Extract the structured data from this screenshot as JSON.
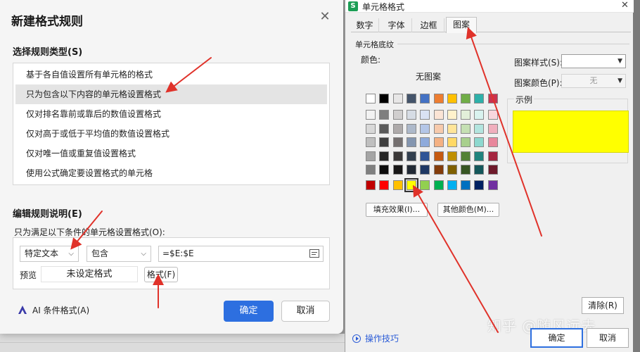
{
  "left_dialog": {
    "title": "新建格式规则",
    "rule_type_heading": "选择规则类型(S)",
    "rule_types": [
      {
        "label": "基于各自值设置所有单元格的格式",
        "selected": false
      },
      {
        "label": "只为包含以下内容的单元格设置格式",
        "selected": true
      },
      {
        "label": "仅对排名靠前或靠后的数值设置格式",
        "selected": false
      },
      {
        "label": "仅对高于或低于平均值的数值设置格式",
        "selected": false
      },
      {
        "label": "仅对唯一值或重复值设置格式",
        "selected": false
      },
      {
        "label": "使用公式确定要设置格式的单元格",
        "selected": false
      }
    ],
    "edit_heading": "编辑规则说明(E)",
    "condition_label": "只为满足以下条件的单元格设置格式(O):",
    "condition_type": "特定文本",
    "operator": "包含",
    "formula_value": "=$E:$E",
    "preview_label": "预览",
    "preview_text": "未设定格式",
    "format_button": "格式(F)",
    "ai_link": "AI 条件格式(A)",
    "ok": "确定",
    "cancel": "取消"
  },
  "right_dialog": {
    "title": "单元格格式",
    "tabs": [
      {
        "label": "数字",
        "active": false
      },
      {
        "label": "字体",
        "active": false
      },
      {
        "label": "边框",
        "active": false
      },
      {
        "label": "图案",
        "active": true
      }
    ],
    "group_label": "单元格底纹",
    "color_label": "颜色:",
    "no_pattern": "无图案",
    "palette_top": [
      "#ffffff",
      "#000000",
      "#e7e6e6",
      "#44546a",
      "#4472c4",
      "#ed7d31",
      "#ffc000",
      "#70ad47",
      "#2eb0a9",
      "#c9334f"
    ],
    "palette_grid": [
      [
        "#f2f2f2",
        "#7f7f7f",
        "#d0cece",
        "#d6dce4",
        "#d9e2f3",
        "#fbe4d5",
        "#fff2cc",
        "#e2efd9",
        "#d9f2ef",
        "#f8d7de"
      ],
      [
        "#d8d8d8",
        "#595959",
        "#aeaaaa",
        "#adb9ca",
        "#b4c6e7",
        "#f7caac",
        "#ffe599",
        "#c5e0b3",
        "#b3e5df",
        "#f0afbd"
      ],
      [
        "#bfbfbf",
        "#3f3f3f",
        "#757070",
        "#8496b0",
        "#8eaadb",
        "#f4b183",
        "#ffd966",
        "#a8d08d",
        "#8dd8cf",
        "#e8879c"
      ],
      [
        "#a5a5a5",
        "#262626",
        "#3a3838",
        "#323f4f",
        "#2f5496",
        "#c55a11",
        "#bf8f00",
        "#538135",
        "#1f837d",
        "#a52640"
      ],
      [
        "#7f7f7f",
        "#0c0c0c",
        "#171616",
        "#222a35",
        "#1f3864",
        "#833c0b",
        "#7f6000",
        "#375623",
        "#14575a",
        "#6e1a2b"
      ]
    ],
    "palette_standard": [
      "#c00000",
      "#ff0000",
      "#ffc000",
      "#ffff00",
      "#92d050",
      "#00b050",
      "#00b0f0",
      "#0070c0",
      "#002060",
      "#7030a0"
    ],
    "selected_color": "#ffff00",
    "fill_effects_button": "填充效果(I)...",
    "more_colors_button": "其他颜色(M)...",
    "pattern_style_label": "图案样式(S):",
    "pattern_style_value": "",
    "pattern_color_label": "图案颜色(P):",
    "pattern_color_value": "无",
    "example_label": "示例",
    "example_color": "#ffff00",
    "clear_button": "清除(R)",
    "tips_link": "操作技巧",
    "ok": "确定",
    "cancel": "取消"
  },
  "watermark": "知乎 @随风远去"
}
